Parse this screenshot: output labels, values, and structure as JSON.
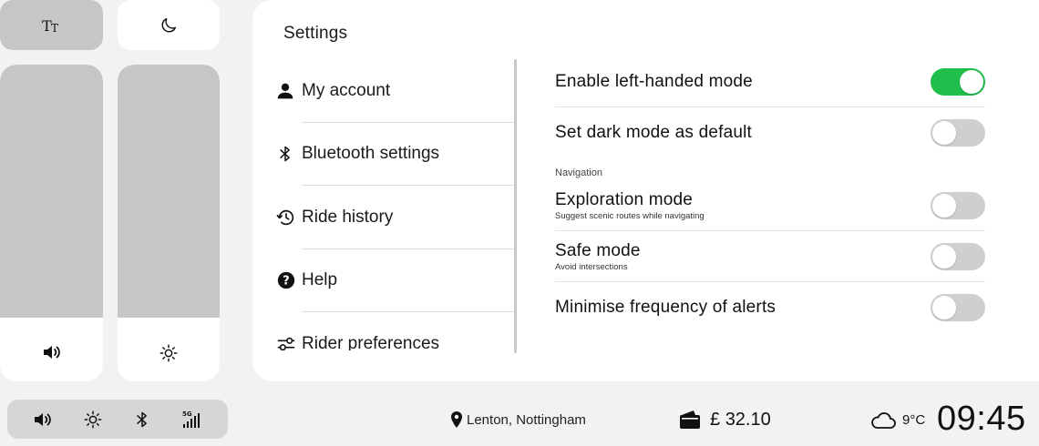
{
  "quick_tiles": {
    "text_size_icon": "text-size-icon",
    "dark_mode_icon": "moon-icon"
  },
  "sliders": {
    "volume": {
      "icon": "speaker-icon",
      "level": 0.2
    },
    "brightness": {
      "icon": "sun-icon",
      "level": 0.2
    }
  },
  "panel": {
    "title": "Settings",
    "menu": [
      {
        "label": "My account",
        "icon": "user-icon"
      },
      {
        "label": "Bluetooth settings",
        "icon": "bluetooth-icon"
      },
      {
        "label": "Ride history",
        "icon": "history-icon"
      },
      {
        "label": "Help",
        "icon": "help-icon"
      },
      {
        "label": "Rider preferences",
        "icon": "sliders-icon"
      }
    ],
    "settings": {
      "left_handed": {
        "label": "Enable left-handed mode",
        "on": true
      },
      "dark_default": {
        "label": "Set dark mode as default",
        "on": false
      },
      "navigation_heading": "Navigation",
      "exploration": {
        "label": "Exploration mode",
        "sublabel": "Suggest scenic routes while navigating",
        "on": false
      },
      "safe": {
        "label": "Safe mode",
        "sublabel": "Avoid intersections",
        "on": false
      },
      "alerts": {
        "label": "Minimise frequency of alerts",
        "on": false
      }
    }
  },
  "status_bar": {
    "icons": [
      "speaker-icon",
      "sun-icon",
      "bluetooth-icon",
      "signal-5g-icon"
    ],
    "network": "5G",
    "location": "Lenton, Nottingham",
    "currency": "£",
    "balance": "32.10",
    "temperature": "9°C",
    "time": "09:45"
  },
  "colors": {
    "accent_on": "#1fbf4c",
    "toggle_off": "#cfcfcf",
    "tile_active": "#c6c6c6",
    "background": "#f2f2f2"
  }
}
